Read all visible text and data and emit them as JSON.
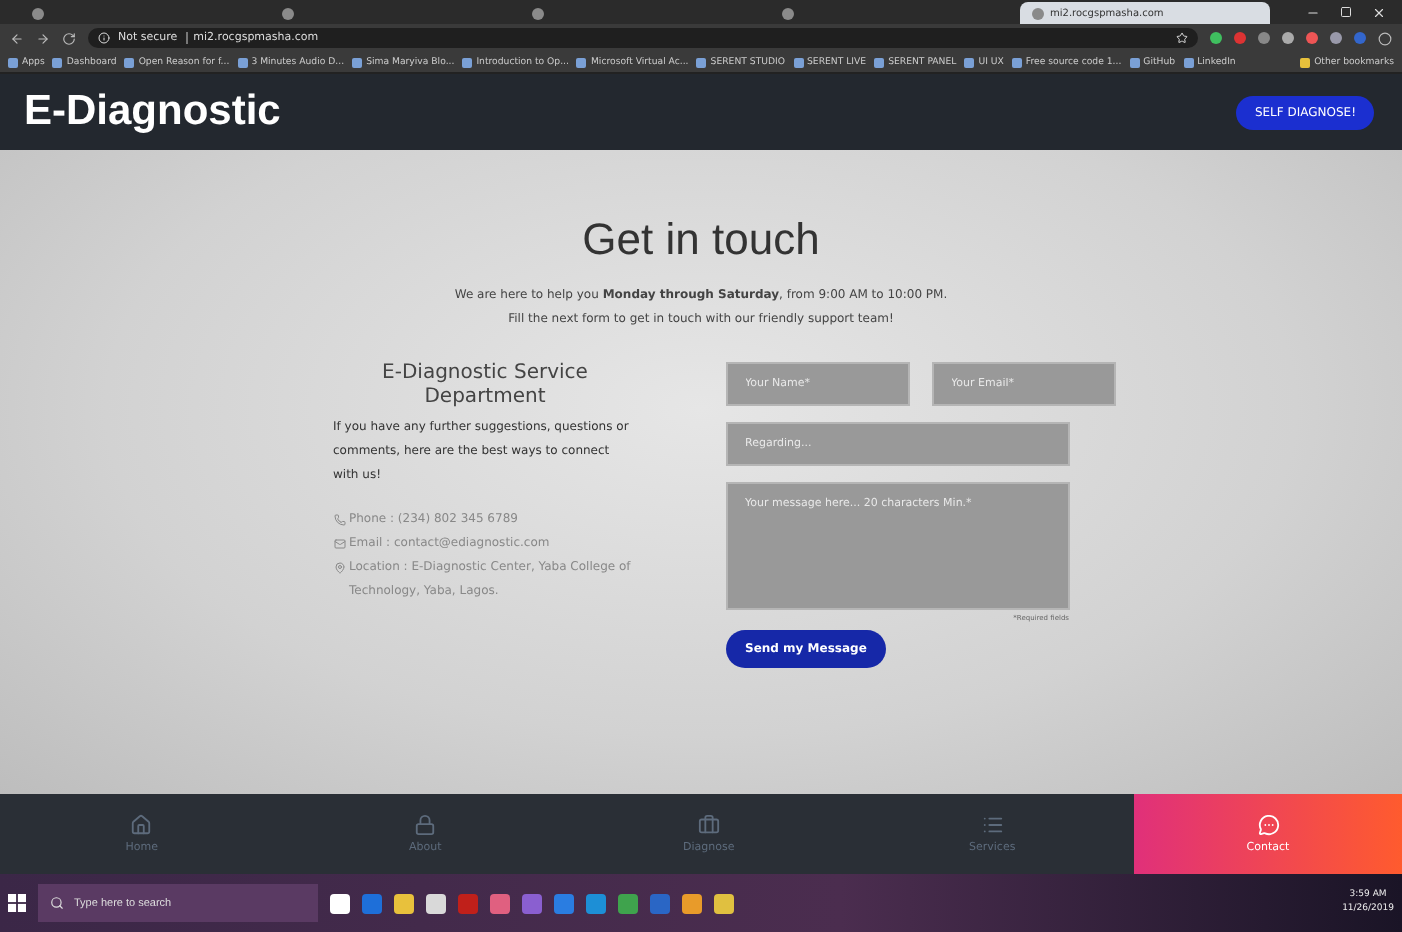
{
  "browser": {
    "tabs": [
      {
        "selected": false
      },
      {
        "selected": false
      },
      {
        "selected": false
      },
      {
        "selected": false
      },
      {
        "title": "mi2.rocgspmasha.com",
        "selected": true
      }
    ],
    "address": {
      "security": "Not secure",
      "url": "mi2.rocgspmasha.com"
    },
    "bookmarks": [
      "Apps",
      "Dashboard",
      "Open Reason for f...",
      "3 Minutes Audio D...",
      "Sima Maryiva Blo...",
      "Introduction to Op...",
      "Microsoft Virtual Ac...",
      "SERENT STUDIO",
      "SERENT LIVE",
      "SERENT PANEL",
      "UI UX",
      "Free source code 1...",
      "GitHub",
      "LinkedIn"
    ],
    "other_bookmarks": "Other bookmarks"
  },
  "header": {
    "brand": "E-Diagnostic",
    "button": "SELF DIAGNOSE!"
  },
  "contact": {
    "title": "Get in touch",
    "intro": "We are here to help you **Monday through Saturday**, from 9:00 AM to 10:00 PM.",
    "subtitle": "Fill the next form to get in touch with our friendly support team!",
    "department": {
      "title": "E-Diagnostic Service Department",
      "text": "If you have any further suggestions, questions or comments, here are the best ways to connect with us!",
      "details": [
        {
          "kind": "phone",
          "text": "Phone : (234) 802 345 6789"
        },
        {
          "kind": "email",
          "text": "Email : contact@ediagnostic.com"
        },
        {
          "kind": "location",
          "text": "Location : E-Diagnostic Center, Yaba College of Technology, Yaba, Lagos."
        }
      ]
    },
    "form": {
      "name": {
        "placeholder": "Your Name*"
      },
      "email": {
        "placeholder": "Your Email*"
      },
      "subject": {
        "placeholder": "Regarding..."
      },
      "message": {
        "placeholder": "Your message here... 20 characters Min.*"
      },
      "note": "*Required fields",
      "submit": "Send my Message"
    }
  },
  "nav": [
    {
      "kind": "home",
      "label": "Home",
      "selected": false
    },
    {
      "kind": "about",
      "label": "About",
      "selected": false
    },
    {
      "kind": "diagnose",
      "label": "Diagnose",
      "selected": false
    },
    {
      "kind": "services",
      "label": "Services",
      "selected": false
    },
    {
      "kind": "contact",
      "label": "Contact",
      "selected": true
    }
  ],
  "taskbar": {
    "search": {
      "placeholder": "Type here to search"
    },
    "time": "3:59 AM",
    "date": "11/26/2019"
  }
}
